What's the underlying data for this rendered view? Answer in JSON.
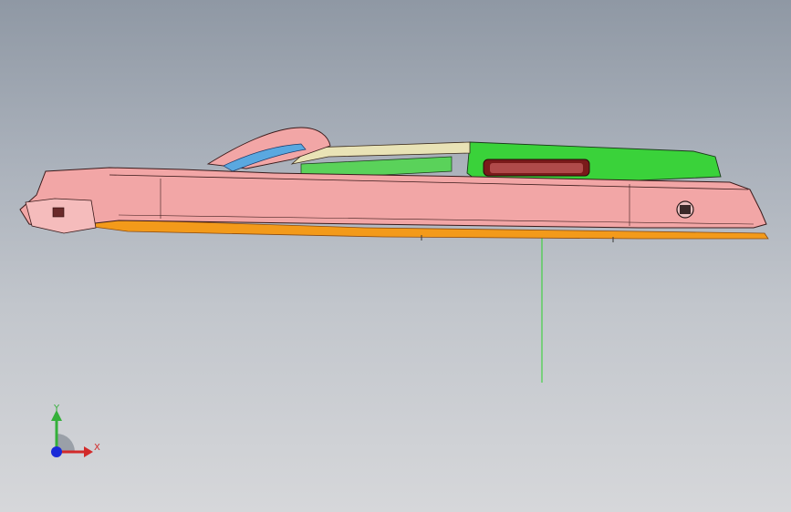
{
  "viewport": {
    "background_top": "#8f98a4",
    "background_bottom": "#d6d7da"
  },
  "model": {
    "body_color": "#f2a6a6",
    "canopy_color": "#3ad23a",
    "deck_color": "#e9e3b6",
    "hull_bottom_color": "#f39a1a",
    "window_color": "#7a1a1a",
    "edge_color": "#3a1a1a"
  },
  "triad": {
    "y_label": "Y",
    "x_label": "X",
    "y_color": "#34b03a",
    "x_color": "#d22a2a",
    "z_color": "#1a2ad8",
    "icons": [
      "y-axis-arrow-icon",
      "x-axis-arrow-icon",
      "z-axis-dot-icon"
    ]
  },
  "reference_line_color": "#2ad22a"
}
